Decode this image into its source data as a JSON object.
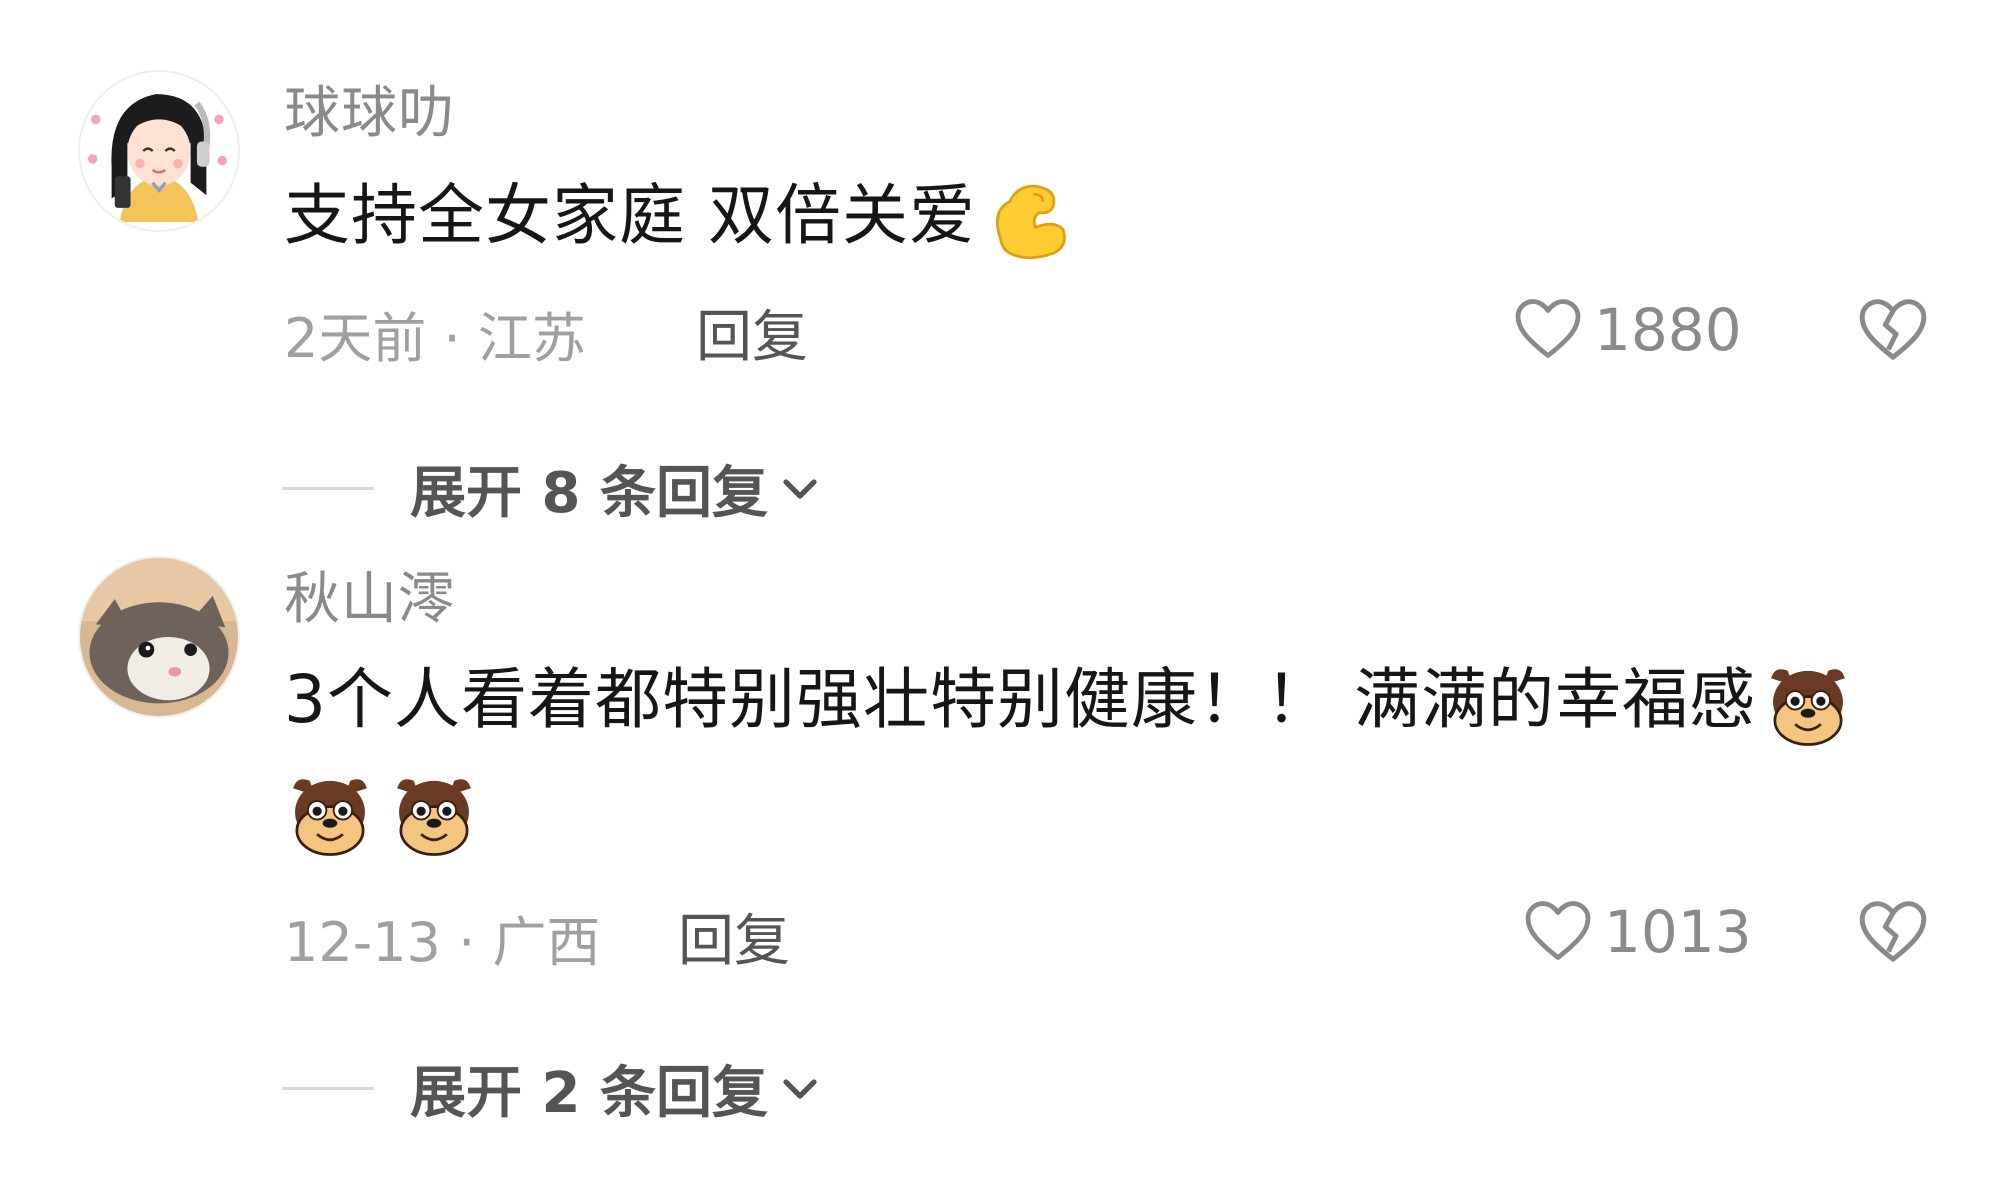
{
  "comments": [
    {
      "username": "球球叻",
      "content": "支持全女家庭 双倍关爱",
      "emoji": "flexed-biceps",
      "time": "2天前",
      "separator": "·",
      "location": "江苏",
      "reply_label": "回复",
      "likes": "1880",
      "expand_label": "展开 8 条回复"
    },
    {
      "username": "秋山澪",
      "content": "3个人看着都特别强壮特别健康！！ 满满的幸福感",
      "emoji": "dog-face",
      "time": "12-13",
      "separator": "·",
      "location": "广西",
      "reply_label": "回复",
      "likes": "1013",
      "expand_label": "展开 2 条回复"
    }
  ],
  "colors": {
    "text_primary": "#161616",
    "text_secondary": "#8a8a8a",
    "text_meta": "#a0a0a0",
    "action": "#555555",
    "biceps": "#ffcc33"
  }
}
